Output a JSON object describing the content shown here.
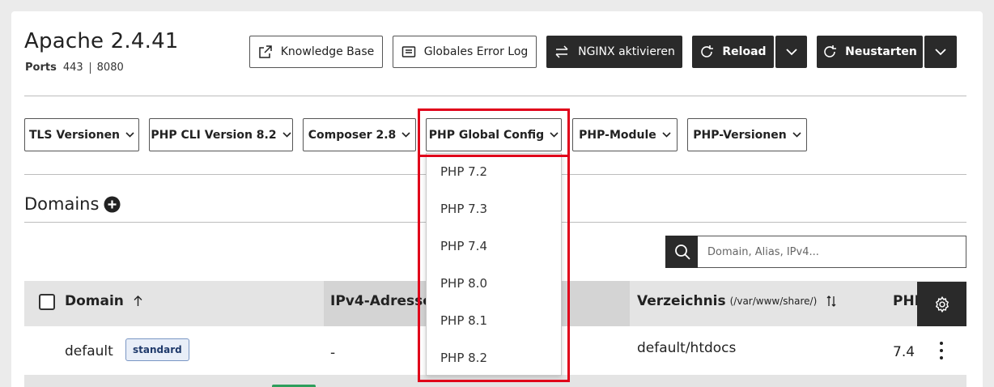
{
  "header": {
    "title": "Apache 2.4.41",
    "ports_label": "Ports",
    "ports": [
      "443",
      "8080"
    ]
  },
  "toolbar": {
    "knowledge_base": "Knowledge Base",
    "error_log": "Globales Error Log",
    "nginx": "NGINX aktivieren",
    "reload": "Reload",
    "restart": "Neustarten"
  },
  "dropdowns": [
    {
      "label": "TLS Versionen"
    },
    {
      "label": "PHP CLI Version 8.2"
    },
    {
      "label": "Composer 2.8"
    },
    {
      "label": "PHP Global Config"
    },
    {
      "label": "PHP-Module"
    },
    {
      "label": "PHP-Versionen"
    }
  ],
  "php_global_menu": {
    "items": [
      "PHP 7.2",
      "PHP 7.3",
      "PHP 7.4",
      "PHP 8.0",
      "PHP 8.1",
      "PHP 8.2"
    ]
  },
  "domains": {
    "heading": "Domains",
    "search_placeholder": "Domain, Alias, IPv4...",
    "columns": {
      "domain": "Domain",
      "ipv4": "IPv4-Adresse",
      "directory": "Verzeichnis",
      "directory_sub": "(/var/www/share/)",
      "php": "PHP"
    },
    "rows": [
      {
        "domain": "default",
        "badge": "standard",
        "ipv4": "-",
        "directory": "default/htdocs",
        "php": "7.4"
      }
    ]
  },
  "colors": {
    "dark_button": "#2a2a2a",
    "highlight": "#e0001a",
    "badge_border": "#7a96c4",
    "header_bg": "#e4e4e4"
  }
}
